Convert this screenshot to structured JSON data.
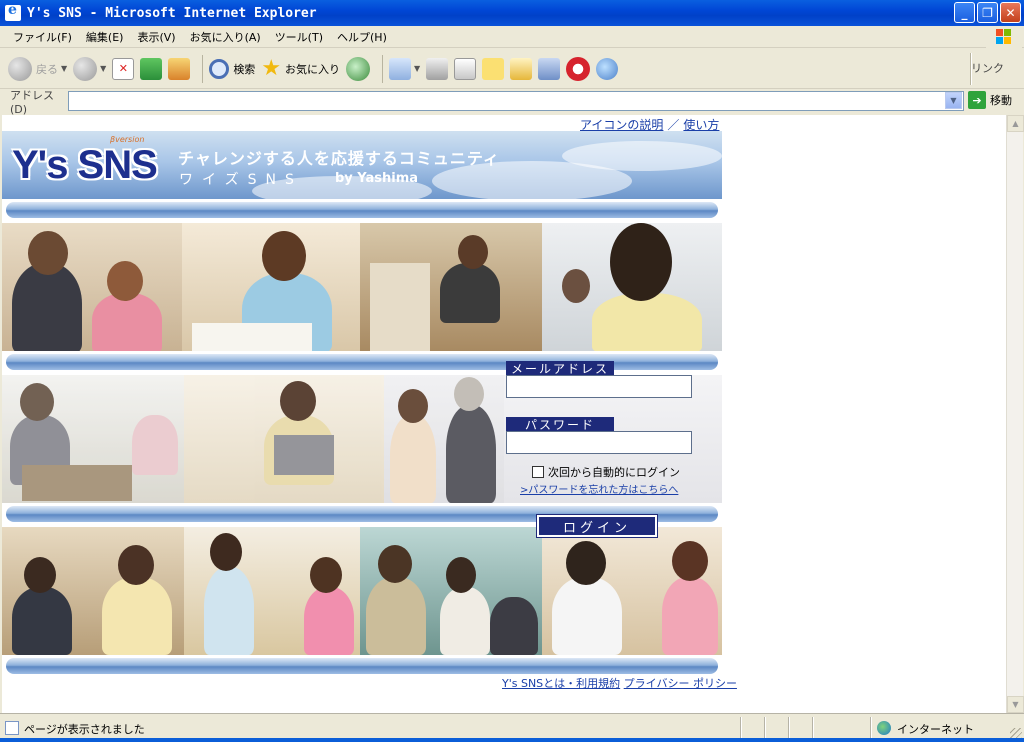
{
  "window": {
    "title": "Y's SNS - Microsoft Internet Explorer",
    "buttons": {
      "minimize": "_",
      "maximize": "❐",
      "close": "✕"
    }
  },
  "menu": [
    "ファイル(F)",
    "編集(E)",
    "表示(V)",
    "お気に入り(A)",
    "ツール(T)",
    "ヘルプ(H)"
  ],
  "toolbar": {
    "back": "戻る",
    "search": "検索",
    "favorites": "お気に入り",
    "links": "リンク"
  },
  "address": {
    "label": "アドレス(D)",
    "value": "",
    "go": "移動"
  },
  "page": {
    "top_links": {
      "icon_help": "アイコンの説明",
      "separator": "／",
      "usage": "使い方"
    },
    "logo": {
      "brand": "Y's SNS",
      "tag": "βversion"
    },
    "slogan": "チャレンジする人を応援するコミュニティ",
    "kana": "ワイズSNS",
    "byline": "by Yashima",
    "login": {
      "email_label": "メールアドレス",
      "email_value": "",
      "password_label": "パスワード",
      "password_value": "",
      "remember_label": "次回から自動的にログイン",
      "forgot_link": ">パスワードを忘れた方はこちらへ",
      "submit": "ログイン"
    },
    "footer": {
      "about": "Y's SNSとは・利用規約",
      "privacy": "プライバシー ポリシー"
    }
  },
  "status": {
    "text": "ページが表示されました",
    "zone": "インターネット"
  },
  "colors": {
    "titlebar": "#0046D5",
    "chrome": "#ECE9D8",
    "brand_navy": "#1E2A7A",
    "link": "#1A3FA8"
  }
}
